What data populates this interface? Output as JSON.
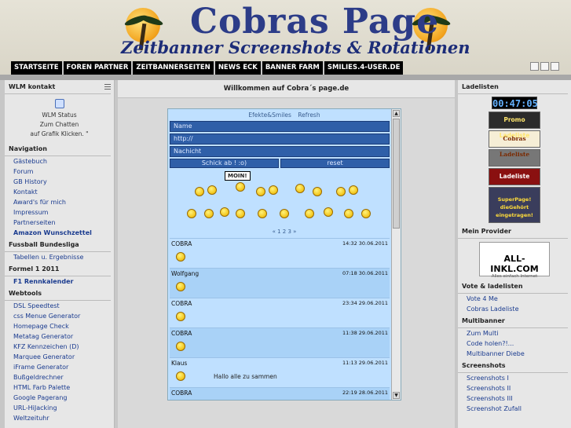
{
  "header": {
    "title": "Cobras Page",
    "subtitle": "Zeitbanner  Screenshots & Rotationen"
  },
  "nav": [
    "STARTSEITE",
    "FOREN PARTNER",
    "ZEITBANNERSEITEN",
    "NEWS ECK",
    "BANNER FARM",
    "SMILIES.4-USER.DE"
  ],
  "left": {
    "wlm_title": "WLM kontakt",
    "wlm_lines": [
      "WLM Status",
      "Zum Chatten",
      "auf Grafik Klicken. \""
    ],
    "sections": [
      {
        "title": "Navigation",
        "items": [
          {
            "label": "Gästebuch",
            "bold": false
          },
          {
            "label": "Forum",
            "bold": false
          },
          {
            "label": "GB History",
            "bold": false
          },
          {
            "label": "Kontakt",
            "bold": false
          },
          {
            "label": "Award's für mich",
            "bold": false
          },
          {
            "label": "Impressum",
            "bold": false
          },
          {
            "label": "Partnerseiten",
            "bold": false
          },
          {
            "label": "Amazon Wunschzettel",
            "bold": true
          }
        ]
      },
      {
        "title": "Fussball Bundesliga",
        "items": [
          {
            "label": "Tabellen u. Ergebnisse",
            "bold": false
          }
        ]
      },
      {
        "title": "Formel 1 2011",
        "items": [
          {
            "label": "F1 Rennkalender",
            "bold": true
          }
        ]
      },
      {
        "title": "Webtools",
        "items": [
          {
            "label": "DSL Speedtest",
            "bold": false
          },
          {
            "label": "css Menue Generator",
            "bold": false
          },
          {
            "label": "Homepage Check",
            "bold": false
          },
          {
            "label": "Metatag Generator",
            "bold": false
          },
          {
            "label": "KFZ Kennzeichen (D)",
            "bold": false
          },
          {
            "label": "Marquee Generator",
            "bold": false
          },
          {
            "label": "iFrame Generator",
            "bold": false
          },
          {
            "label": "Bußgeldrechner",
            "bold": false
          },
          {
            "label": "HTML Farb Palette",
            "bold": false
          },
          {
            "label": "Google Pagerang",
            "bold": false
          },
          {
            "label": "URL-HiJacking",
            "bold": false
          },
          {
            "label": "Weltzeituhr",
            "bold": false
          }
        ]
      }
    ]
  },
  "main": {
    "title": "Willkommen auf Cobra´s page.de",
    "shoutbox": {
      "top": "Efekte&Smiles  Refresh",
      "name_placeholder": "Name",
      "url_placeholder": "http://",
      "message_placeholder": "Nachicht",
      "send_label": "Schick ab ! :o)",
      "reset_label": "reset",
      "moin": "MOIN!",
      "pager": "« 1 2 3 »",
      "entries": [
        {
          "name": "COBRA",
          "time": "14:32 30.06.2011",
          "text": "",
          "alt": false
        },
        {
          "name": "Wolfgang",
          "time": "07:18 30.06.2011",
          "text": "",
          "alt": true
        },
        {
          "name": "COBRA",
          "time": "23:34 29.06.2011",
          "text": "",
          "alt": false
        },
        {
          "name": "COBRA",
          "time": "11:38 29.06.2011",
          "text": "",
          "alt": true
        },
        {
          "name": "Klaus",
          "time": "11:13 29.06.2011",
          "text": "Hallo alle zu sammen",
          "alt": false
        },
        {
          "name": "COBRA",
          "time": "22:19 28.06.2011",
          "text": "",
          "alt": true
        }
      ]
    }
  },
  "right": {
    "ladelisten_title": "Ladelisten",
    "clock": "00:47:05",
    "badges": [
      "Promo Ladeliste",
      "Cobras Ladeliste",
      "",
      "Ladeliste",
      "SuperPage! dieGehört eingetragen!"
    ],
    "provider_title": "Mein Provider",
    "provider_logo": "ALL-INKL.COM",
    "provider_tag": "Alles einfach Internet",
    "vote_title": "Vote & ladelisten",
    "vote_items": [
      "Vote 4 Me",
      "Cobras Ladeliste"
    ],
    "multibanner_title": "Multibanner",
    "multibanner_items": [
      "Zum Multi",
      "Code holen?!...",
      "Multibanner Diebe"
    ],
    "screenshots_title": "Screenshots",
    "screenshots_items": [
      "Screenshots I",
      "Screenshots II",
      "Screenshots III",
      "Screenshot Zufall"
    ]
  }
}
